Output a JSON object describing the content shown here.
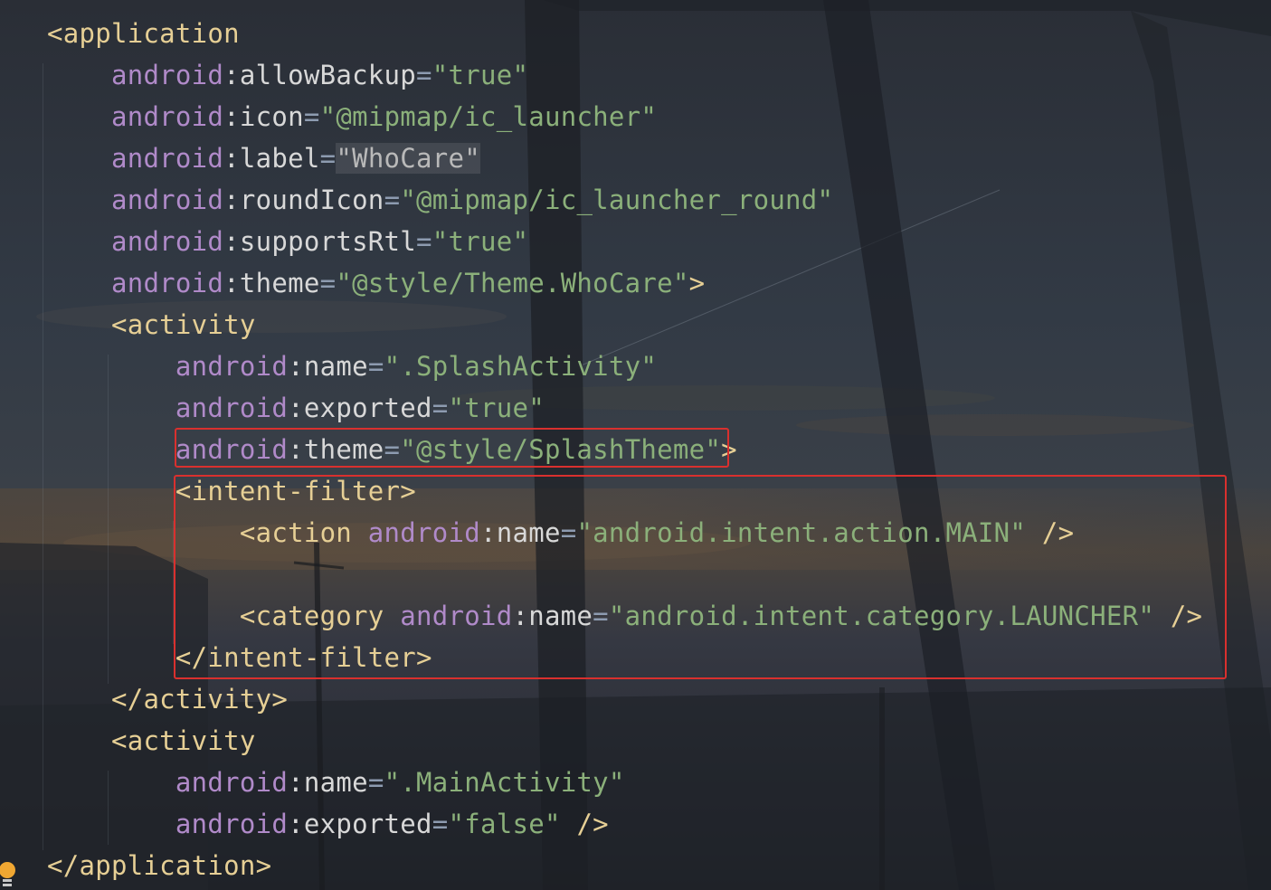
{
  "editor": {
    "lines": [
      [
        {
          "t": "<application",
          "c": "t-tag"
        }
      ],
      [
        {
          "t": "    "
        },
        {
          "t": "android",
          "c": "t-ns"
        },
        {
          "t": ":allowBackup",
          "c": "t-plain"
        },
        {
          "t": "=",
          "c": "t-eq"
        },
        {
          "t": "\"true\"",
          "c": "t-str"
        }
      ],
      [
        {
          "t": "    "
        },
        {
          "t": "android",
          "c": "t-ns"
        },
        {
          "t": ":icon",
          "c": "t-plain"
        },
        {
          "t": "=",
          "c": "t-eq"
        },
        {
          "t": "\"@mipmap/ic_launcher\"",
          "c": "t-str"
        }
      ],
      [
        {
          "t": "    "
        },
        {
          "t": "android",
          "c": "t-ns"
        },
        {
          "t": ":label",
          "c": "t-plain"
        },
        {
          "t": "=",
          "c": "t-eq"
        },
        {
          "t": "\"WhoCare\"",
          "c": "t-str-dim str-bg"
        }
      ],
      [
        {
          "t": "    "
        },
        {
          "t": "android",
          "c": "t-ns"
        },
        {
          "t": ":roundIcon",
          "c": "t-plain"
        },
        {
          "t": "=",
          "c": "t-eq"
        },
        {
          "t": "\"@mipmap/ic_launcher_round\"",
          "c": "t-str"
        }
      ],
      [
        {
          "t": "    "
        },
        {
          "t": "android",
          "c": "t-ns"
        },
        {
          "t": ":supportsRtl",
          "c": "t-plain"
        },
        {
          "t": "=",
          "c": "t-eq"
        },
        {
          "t": "\"true\"",
          "c": "t-str"
        }
      ],
      [
        {
          "t": "    "
        },
        {
          "t": "android",
          "c": "t-ns"
        },
        {
          "t": ":theme",
          "c": "t-plain"
        },
        {
          "t": "=",
          "c": "t-eq"
        },
        {
          "t": "\"@style/Theme.WhoCare\"",
          "c": "t-str"
        },
        {
          "t": ">",
          "c": "t-tag"
        }
      ],
      [
        {
          "t": "    "
        },
        {
          "t": "<activity",
          "c": "t-tag"
        }
      ],
      [
        {
          "t": "        "
        },
        {
          "t": "android",
          "c": "t-ns"
        },
        {
          "t": ":name",
          "c": "t-plain"
        },
        {
          "t": "=",
          "c": "t-eq"
        },
        {
          "t": "\".SplashActivity\"",
          "c": "t-str"
        }
      ],
      [
        {
          "t": "        "
        },
        {
          "t": "android",
          "c": "t-ns"
        },
        {
          "t": ":exported",
          "c": "t-plain"
        },
        {
          "t": "=",
          "c": "t-eq"
        },
        {
          "t": "\"true\"",
          "c": "t-str"
        }
      ],
      [
        {
          "t": "        "
        },
        {
          "t": "android",
          "c": "t-ns"
        },
        {
          "t": ":theme",
          "c": "t-plain"
        },
        {
          "t": "=",
          "c": "t-eq"
        },
        {
          "t": "\"@style/SplashTheme\"",
          "c": "t-str"
        },
        {
          "t": ">",
          "c": "t-tag"
        }
      ],
      [
        {
          "t": "        "
        },
        {
          "t": "<intent-filter>",
          "c": "t-tag"
        }
      ],
      [
        {
          "t": "            "
        },
        {
          "t": "<action ",
          "c": "t-tag"
        },
        {
          "t": "android",
          "c": "t-ns"
        },
        {
          "t": ":name",
          "c": "t-plain"
        },
        {
          "t": "=",
          "c": "t-eq"
        },
        {
          "t": "\"android.intent.action.MAIN\"",
          "c": "t-str"
        },
        {
          "t": " />",
          "c": "t-tag"
        }
      ],
      [],
      [
        {
          "t": "            "
        },
        {
          "t": "<category ",
          "c": "t-tag"
        },
        {
          "t": "android",
          "c": "t-ns"
        },
        {
          "t": ":name",
          "c": "t-plain"
        },
        {
          "t": "=",
          "c": "t-eq"
        },
        {
          "t": "\"android.intent.category.LAUNCHER\"",
          "c": "t-str"
        },
        {
          "t": " />",
          "c": "t-tag"
        }
      ],
      [
        {
          "t": "        "
        },
        {
          "t": "</intent-filter>",
          "c": "t-tag"
        }
      ],
      [
        {
          "t": "    "
        },
        {
          "t": "</activity>",
          "c": "t-tag"
        }
      ],
      [
        {
          "t": "    "
        },
        {
          "t": "<activity",
          "c": "t-tag"
        }
      ],
      [
        {
          "t": "        "
        },
        {
          "t": "android",
          "c": "t-ns"
        },
        {
          "t": ":name",
          "c": "t-plain"
        },
        {
          "t": "=",
          "c": "t-eq"
        },
        {
          "t": "\".MainActivity\"",
          "c": "t-str"
        }
      ],
      [
        {
          "t": "        "
        },
        {
          "t": "android",
          "c": "t-ns"
        },
        {
          "t": ":exported",
          "c": "t-plain"
        },
        {
          "t": "=",
          "c": "t-eq"
        },
        {
          "t": "\"false\"",
          "c": "t-str"
        },
        {
          "t": " />",
          "c": "t-tag"
        }
      ],
      [
        {
          "t": "</application>",
          "c": "t-tag"
        }
      ]
    ]
  },
  "highlights": [
    {
      "name": "theme-attribute-highlight",
      "color": "#d9302e"
    },
    {
      "name": "intent-filter-highlight",
      "color": "#d9302e"
    }
  ],
  "gutter": {
    "icon": "lightbulb-icon"
  }
}
